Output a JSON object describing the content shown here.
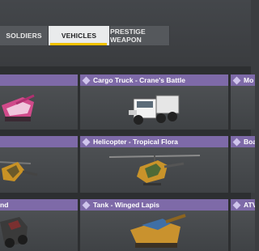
{
  "tabs": {
    "soldiers": "SOLDIERS",
    "vehicles": "VEHICLES",
    "prestige": "PRESTIGE WEAPON"
  },
  "cards": {
    "r1c1": "",
    "r1c2": "Cargo Truck - Crane's Battle",
    "r1c3": "Mo",
    "r2c1": "",
    "r2c2": "Helicopter - Tropical Flora",
    "r2c3": "Boa",
    "r3c1": "nd",
    "r3c2": "Tank - Winged Lapis",
    "r3c3": "ATV"
  },
  "colors": {
    "header": "#7e6aa8",
    "active_tab": "#e9ebec",
    "underline": "#f2c200"
  },
  "icons": [
    "rarity-diamond-icon"
  ]
}
